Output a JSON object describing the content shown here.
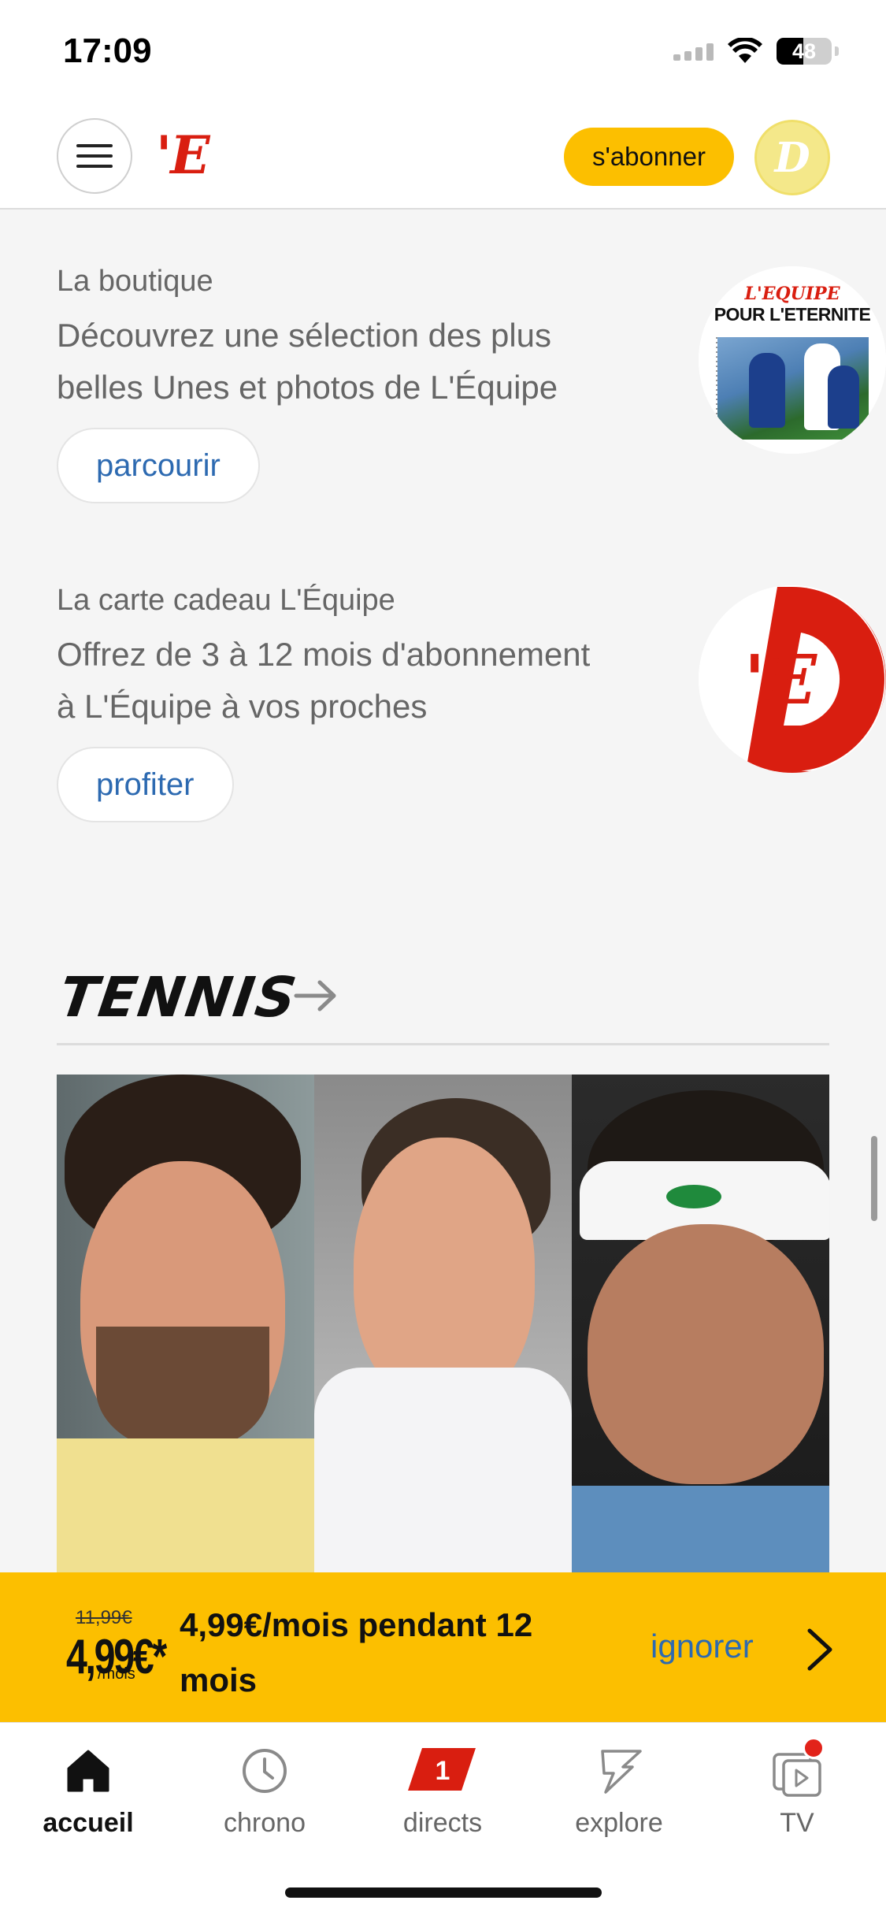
{
  "status_bar": {
    "time": "17:09",
    "battery": "48",
    "battery_level": 0.48
  },
  "header": {
    "logo": "'E",
    "subscribe_label": "s'abonner",
    "avatar_letter": "D"
  },
  "promos": [
    {
      "title": "La boutique",
      "description": "Découvrez une sélection des plus belles Unes et photos de L'Équipe",
      "button": "parcourir",
      "image": {
        "masthead": "L'EQUIPE",
        "headline": "POUR L'ETERNITE"
      }
    },
    {
      "title": "La carte cadeau L'Équipe",
      "description": "Offrez de 3 à 12 mois d'abonnement à L'Équipe à vos proches",
      "button": "profiter",
      "image": {
        "logo": "'E"
      }
    }
  ],
  "section": {
    "title": "TENNIS"
  },
  "offer": {
    "old_price": "11,99€",
    "new_price": "4,99€*",
    "unit": "/mois",
    "text": "4,99€/mois pendant 12 mois",
    "ignore_label": "ignorer"
  },
  "tabbar": {
    "items": [
      {
        "label": "accueil",
        "icon": "home-icon",
        "active": true
      },
      {
        "label": "chrono",
        "icon": "clock-icon",
        "active": false
      },
      {
        "label": "directs",
        "icon": "live-icon",
        "badge": "1",
        "active": false
      },
      {
        "label": "explore",
        "icon": "explore-icon",
        "active": false
      },
      {
        "label": "TV",
        "icon": "tv-icon",
        "active": false
      }
    ]
  },
  "colors": {
    "brand_red": "#d91e10",
    "accent_yellow": "#fcbf00",
    "link_blue": "#2d6ab1"
  }
}
